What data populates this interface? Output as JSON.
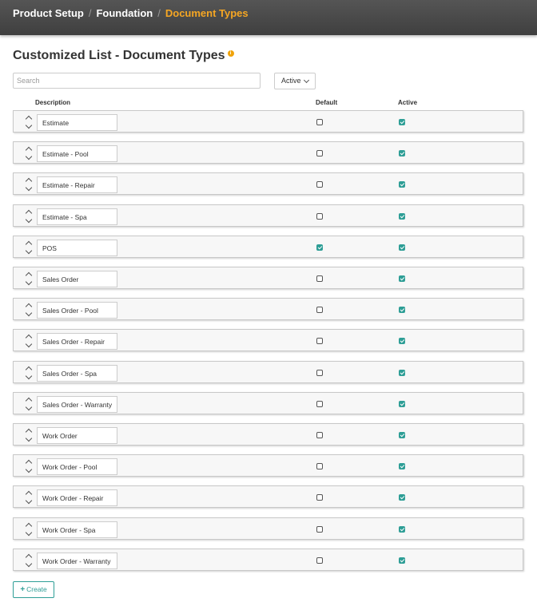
{
  "breadcrumb": [
    "Product Setup",
    "Foundation",
    "Document Types"
  ],
  "page": {
    "title": "Customized List - Document Types",
    "info_icon": "info-icon"
  },
  "search": {
    "placeholder": "Search",
    "value": ""
  },
  "status_filter": {
    "selected": "Active"
  },
  "columns": {
    "description": "Description",
    "default": "Default",
    "active": "Active"
  },
  "rows": [
    {
      "description": "Estimate",
      "default": false,
      "active": true
    },
    {
      "description": "Estimate - Pool",
      "default": false,
      "active": true
    },
    {
      "description": "Estimate - Repair",
      "default": false,
      "active": true
    },
    {
      "description": "Estimate - Spa",
      "default": false,
      "active": true
    },
    {
      "description": "POS",
      "default": true,
      "active": true
    },
    {
      "description": "Sales Order",
      "default": false,
      "active": true
    },
    {
      "description": "Sales Order - Pool",
      "default": false,
      "active": true
    },
    {
      "description": "Sales Order - Repair",
      "default": false,
      "active": true
    },
    {
      "description": "Sales Order - Spa",
      "default": false,
      "active": true
    },
    {
      "description": "Sales Order - Warranty",
      "default": false,
      "active": true
    },
    {
      "description": "Work Order",
      "default": false,
      "active": true
    },
    {
      "description": "Work Order - Pool",
      "default": false,
      "active": true
    },
    {
      "description": "Work Order - Repair",
      "default": false,
      "active": true
    },
    {
      "description": "Work Order - Spa",
      "default": false,
      "active": true
    },
    {
      "description": "Work Order - Warranty",
      "default": false,
      "active": true
    }
  ],
  "create_button": {
    "label": "Create",
    "icon": "plus-icon"
  },
  "colors": {
    "accent": "#f5a623",
    "teal": "#2e9e96",
    "topbar": "#4a4a4a"
  }
}
